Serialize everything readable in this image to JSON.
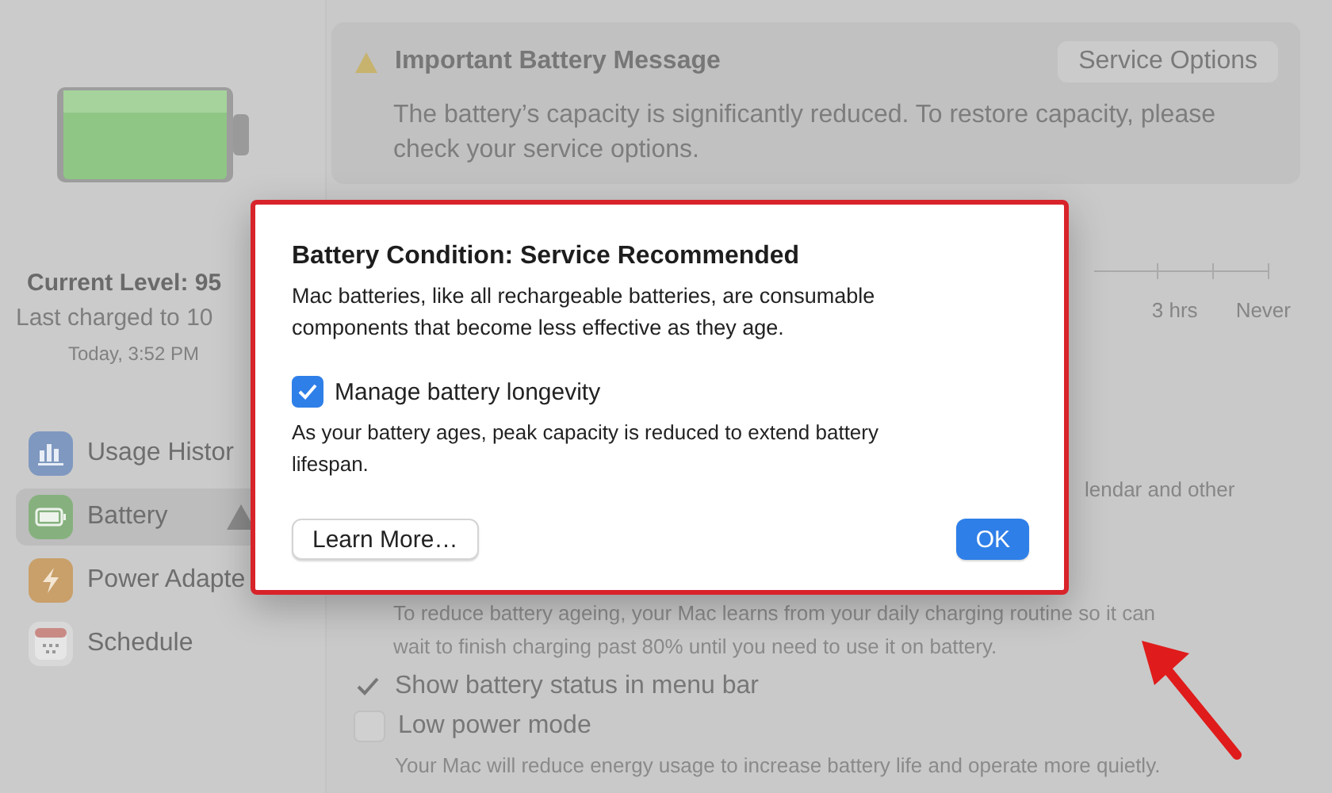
{
  "sidebar": {
    "current_level": "Current Level: 95",
    "last_charged": "Last charged to 10",
    "charged_time": "Today, 3:52 PM",
    "items": [
      {
        "label": "Usage Histor",
        "kind": "usage",
        "selected": false,
        "warning": false
      },
      {
        "label": "Battery",
        "kind": "battery",
        "selected": true,
        "warning": true
      },
      {
        "label": "Power Adapte",
        "kind": "power",
        "selected": false,
        "warning": false
      },
      {
        "label": "Schedule",
        "kind": "schedule",
        "selected": false,
        "warning": false
      }
    ]
  },
  "message": {
    "title": "Important Battery Message",
    "button": "Service Options",
    "body": "The battery’s capacity is significantly reduced. To restore capacity, please check your service options."
  },
  "slider_labels": [
    "3 hrs",
    "Never"
  ],
  "settings": {
    "calendar_text": "lendar and other",
    "optimized_text": "To reduce battery ageing, your Mac learns from your daily charging routine so it can wait to finish charging past 80% until you need to use it on battery.",
    "options": [
      {
        "label": "Show battery status in menu bar",
        "checked": true
      },
      {
        "label": "Low power mode",
        "checked": false,
        "description": "Your Mac will reduce energy usage to increase battery life and operate more quietly."
      }
    ]
  },
  "dialog": {
    "title": "Battery Condition: Service Recommended",
    "body": "Mac batteries, like all rechargeable batteries, are consumable components that become less effective as they age.",
    "checkbox": {
      "label": "Manage battery longevity",
      "checked": true
    },
    "note": "As your battery ages, peak capacity is reduced to extend battery lifespan.",
    "buttons": [
      {
        "label": "Learn More…",
        "kind": "secondary"
      },
      {
        "label": "OK",
        "kind": "primary"
      }
    ]
  }
}
